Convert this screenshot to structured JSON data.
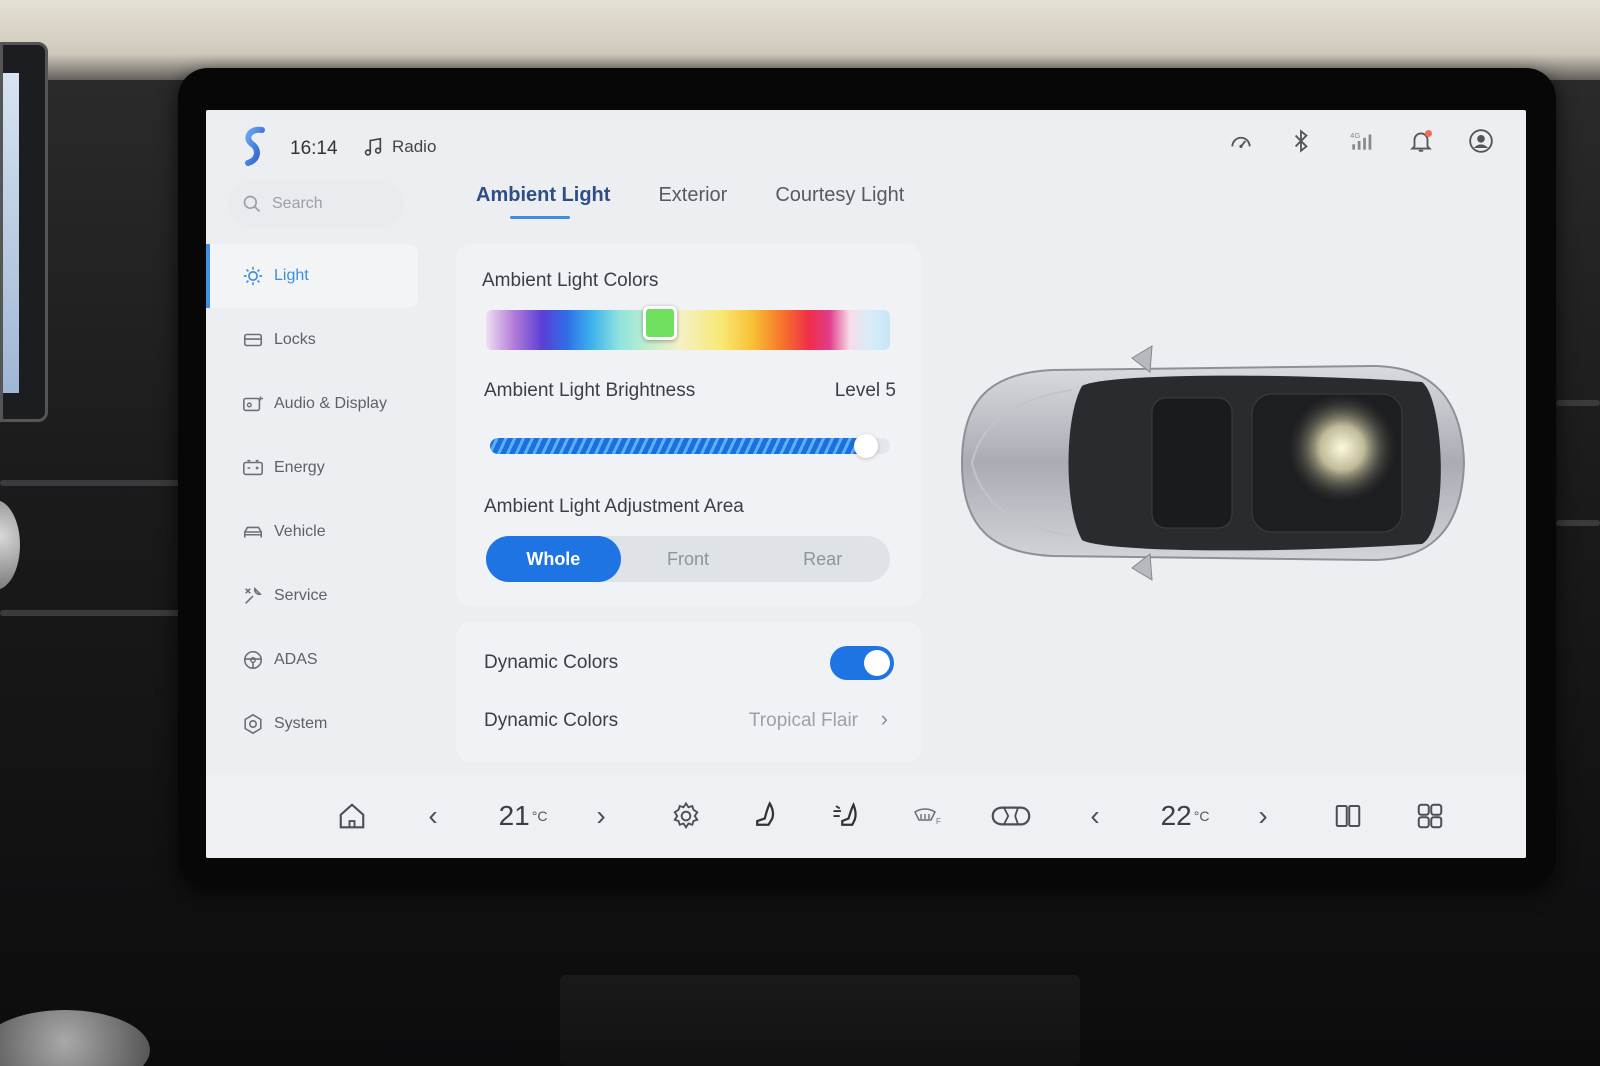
{
  "status_bar": {
    "time": "16:14",
    "media_label": "Radio",
    "icons": [
      "speedometer-icon",
      "bluetooth-icon",
      "signal-4g-icon",
      "bell-icon",
      "user-icon"
    ]
  },
  "sidebar": {
    "search_placeholder": "Search",
    "items": [
      {
        "label": "Light",
        "icon": "sun-icon",
        "active": true
      },
      {
        "label": "Locks",
        "icon": "lock-icon",
        "active": false
      },
      {
        "label": "Audio & Display",
        "icon": "display-icon",
        "active": false
      },
      {
        "label": "Energy",
        "icon": "battery-icon",
        "active": false
      },
      {
        "label": "Vehicle",
        "icon": "car-icon",
        "active": false
      },
      {
        "label": "Service",
        "icon": "wrench-icon",
        "active": false
      },
      {
        "label": "ADAS",
        "icon": "steering-wheel-icon",
        "active": false
      },
      {
        "label": "System",
        "icon": "settings-icon",
        "active": false
      }
    ]
  },
  "tabs": [
    {
      "label": "Ambient Light",
      "active": true
    },
    {
      "label": "Exterior",
      "active": false
    },
    {
      "label": "Courtesy Light",
      "active": false
    }
  ],
  "ambient": {
    "colors_label": "Ambient Light Colors",
    "selected_color": "#6ee05e",
    "selected_position": 0.43,
    "brightness_label": "Ambient Light Brightness",
    "brightness_value": "Level 5",
    "brightness_fraction": 0.94,
    "area_label": "Ambient Light Adjustment Area",
    "area_options": [
      "Whole",
      "Front",
      "Rear"
    ],
    "area_selected": "Whole"
  },
  "dynamic": {
    "toggle_label": "Dynamic Colors",
    "toggle_on": true,
    "mode_label": "Dynamic Colors",
    "mode_value": "Tropical Flair"
  },
  "bottom_bar": {
    "left_temp": "21",
    "right_temp": "22",
    "temp_unit": "°C",
    "icons": [
      "home-icon",
      "chevron-left-icon",
      "chevron-right-icon",
      "fan-settings-icon",
      "seat-icon",
      "airflow-icon",
      "defrost-front-icon",
      "car-top-icon",
      "chevron-left-icon",
      "chevron-right-icon",
      "split-screen-icon",
      "app-grid-icon"
    ]
  },
  "colors": {
    "accent": "#1f74e3",
    "tab_active": "#2e4f86",
    "screen_bg": "#eceef2"
  }
}
